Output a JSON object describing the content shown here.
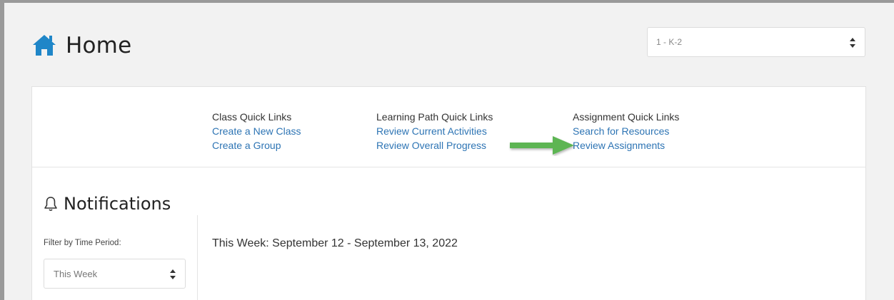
{
  "header": {
    "title": "Home",
    "class_select_value": "1 - K-2"
  },
  "quick_links": {
    "class": {
      "title": "Class Quick Links",
      "links": [
        "Create a New Class",
        "Create a Group"
      ]
    },
    "learning_path": {
      "title": "Learning Path Quick Links",
      "links": [
        "Review Current Activities",
        "Review Overall Progress"
      ]
    },
    "assignment": {
      "title": "Assignment Quick Links",
      "links": [
        "Search for Resources",
        "Review Assignments"
      ]
    }
  },
  "notifications": {
    "title": "Notifications",
    "filter_label": "Filter by Time Period:",
    "filter_value": "This Week",
    "week_heading": "This Week: September 12 - September 13, 2022"
  },
  "colors": {
    "accent": "#1f86c8",
    "link": "#2d74b4",
    "arrow": "#5db552"
  }
}
